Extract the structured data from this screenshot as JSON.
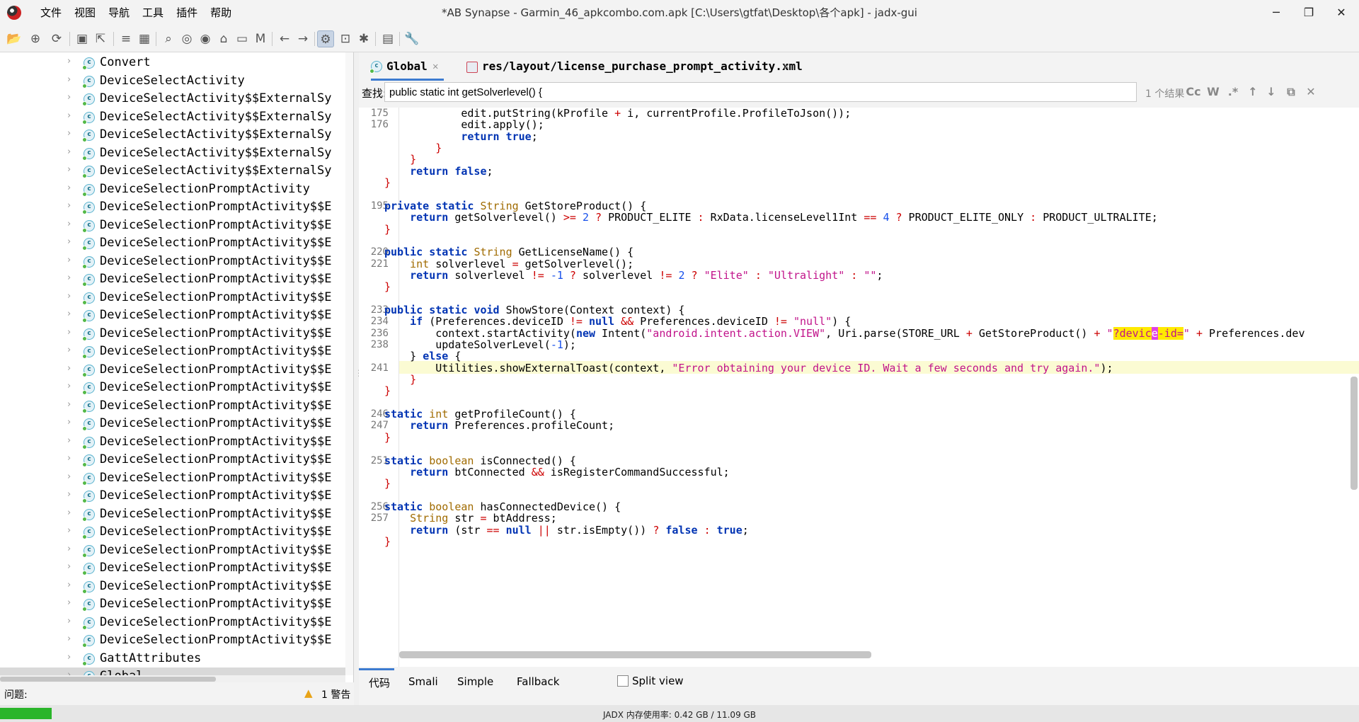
{
  "window": {
    "title": "*AB Synapse - Garmin_46_apkcombo.com.apk [C:\\Users\\gtfat\\Desktop\\各个apk] - jadx-gui",
    "minimize": "─",
    "maximize": "❐",
    "close": "✕"
  },
  "menu": [
    "文件",
    "视图",
    "导航",
    "工具",
    "插件",
    "帮助"
  ],
  "toolbar_icons": [
    "open-icon",
    "add-file-icon",
    "sync-icon",
    "save-icon",
    "export-icon",
    "text-search-icon",
    "class-search-icon",
    "search-icon",
    "usage-search-icon",
    "find-usage-icon",
    "home-icon",
    "window-icon",
    "kotlin-icon",
    "back-icon",
    "forward-icon",
    "deobfuscation-icon",
    "quark-icon",
    "debug-icon",
    "log-icon",
    "settings-icon"
  ],
  "tree": {
    "items": [
      {
        "label": "Convert",
        "selected": false
      },
      {
        "label": "DeviceSelectActivity",
        "selected": false
      },
      {
        "label": "DeviceSelectActivity$$ExternalSy",
        "selected": false
      },
      {
        "label": "DeviceSelectActivity$$ExternalSy",
        "selected": false
      },
      {
        "label": "DeviceSelectActivity$$ExternalSy",
        "selected": false
      },
      {
        "label": "DeviceSelectActivity$$ExternalSy",
        "selected": false
      },
      {
        "label": "DeviceSelectActivity$$ExternalSy",
        "selected": false
      },
      {
        "label": "DeviceSelectionPromptActivity",
        "selected": false
      },
      {
        "label": "DeviceSelectionPromptActivity$$E",
        "selected": false
      },
      {
        "label": "DeviceSelectionPromptActivity$$E",
        "selected": false
      },
      {
        "label": "DeviceSelectionPromptActivity$$E",
        "selected": false
      },
      {
        "label": "DeviceSelectionPromptActivity$$E",
        "selected": false
      },
      {
        "label": "DeviceSelectionPromptActivity$$E",
        "selected": false
      },
      {
        "label": "DeviceSelectionPromptActivity$$E",
        "selected": false
      },
      {
        "label": "DeviceSelectionPromptActivity$$E",
        "selected": false
      },
      {
        "label": "DeviceSelectionPromptActivity$$E",
        "selected": false
      },
      {
        "label": "DeviceSelectionPromptActivity$$E",
        "selected": false
      },
      {
        "label": "DeviceSelectionPromptActivity$$E",
        "selected": false
      },
      {
        "label": "DeviceSelectionPromptActivity$$E",
        "selected": false
      },
      {
        "label": "DeviceSelectionPromptActivity$$E",
        "selected": false
      },
      {
        "label": "DeviceSelectionPromptActivity$$E",
        "selected": false
      },
      {
        "label": "DeviceSelectionPromptActivity$$E",
        "selected": false
      },
      {
        "label": "DeviceSelectionPromptActivity$$E",
        "selected": false
      },
      {
        "label": "DeviceSelectionPromptActivity$$E",
        "selected": false
      },
      {
        "label": "DeviceSelectionPromptActivity$$E",
        "selected": false
      },
      {
        "label": "DeviceSelectionPromptActivity$$E",
        "selected": false
      },
      {
        "label": "DeviceSelectionPromptActivity$$E",
        "selected": false
      },
      {
        "label": "DeviceSelectionPromptActivity$$E",
        "selected": false
      },
      {
        "label": "DeviceSelectionPromptActivity$$E",
        "selected": false
      },
      {
        "label": "DeviceSelectionPromptActivity$$E",
        "selected": false
      },
      {
        "label": "DeviceSelectionPromptActivity$$E",
        "selected": false
      },
      {
        "label": "DeviceSelectionPromptActivity$$E",
        "selected": false
      },
      {
        "label": "DeviceSelectionPromptActivity$$E",
        "selected": false
      },
      {
        "label": "GattAttributes",
        "selected": false
      },
      {
        "label": "Global",
        "selected": true
      }
    ]
  },
  "problems": {
    "label": "问题:",
    "warning": "1 警告"
  },
  "tabs": [
    {
      "label": "Global",
      "active": true,
      "icon": "class-icon"
    },
    {
      "label": "res/layout/license_purchase_prompt_activity.xml",
      "active": false,
      "icon": "xml-icon"
    }
  ],
  "search": {
    "label": "查找:",
    "value": "public static int getSolverlevel() {",
    "count": "1 个结果",
    "opt_case": "Cc",
    "opt_word": "W",
    "opt_regex": ".*",
    "opt_up": "↑",
    "opt_down": "↓",
    "opt_find": "⧉",
    "opt_close": "✕"
  },
  "code": {
    "line_numbers": [
      {
        "n": "175",
        "row": 0
      },
      {
        "n": "176",
        "row": 1
      },
      {
        "n": "195",
        "row": 8
      },
      {
        "n": "220",
        "row": 12
      },
      {
        "n": "221",
        "row": 13
      },
      {
        "n": "233",
        "row": 17
      },
      {
        "n": "234",
        "row": 18
      },
      {
        "n": "236",
        "row": 19
      },
      {
        "n": "238",
        "row": 20
      },
      {
        "n": "241",
        "row": 22
      },
      {
        "n": "246",
        "row": 26
      },
      {
        "n": "247",
        "row": 27
      },
      {
        "n": "251",
        "row": 30
      },
      {
        "n": "256",
        "row": 34
      },
      {
        "n": "257",
        "row": 35
      }
    ],
    "lines": [
      [
        {
          "t": "            edit.putString(kProfile "
        },
        {
          "t": "+",
          "c": "op"
        },
        {
          "t": " i, currentProfile.ProfileToJson());"
        }
      ],
      [
        {
          "t": "            edit.apply();"
        }
      ],
      [
        {
          "t": "            "
        },
        {
          "t": "return",
          "c": "kw"
        },
        {
          "t": " "
        },
        {
          "t": "true",
          "c": "kw"
        },
        {
          "t": ";"
        }
      ],
      [
        {
          "t": "        }",
          "c": "op"
        }
      ],
      [
        {
          "t": "    }",
          "c": "op"
        }
      ],
      [
        {
          "t": "    "
        },
        {
          "t": "return",
          "c": "kw"
        },
        {
          "t": " "
        },
        {
          "t": "false",
          "c": "kw"
        },
        {
          "t": ";"
        }
      ],
      [
        {
          "t": "}",
          "c": "op"
        }
      ],
      [
        {
          "t": ""
        }
      ],
      [
        {
          "t": "private",
          "c": "kw"
        },
        {
          "t": " "
        },
        {
          "t": "static",
          "c": "kw"
        },
        {
          "t": " "
        },
        {
          "t": "String",
          "c": "ty"
        },
        {
          "t": " GetStoreProduct() {"
        }
      ],
      [
        {
          "t": "    "
        },
        {
          "t": "return",
          "c": "kw"
        },
        {
          "t": " getSolverlevel() "
        },
        {
          "t": ">=",
          "c": "op"
        },
        {
          "t": " "
        },
        {
          "t": "2",
          "c": "num"
        },
        {
          "t": " "
        },
        {
          "t": "?",
          "c": "op"
        },
        {
          "t": " PRODUCT_ELITE "
        },
        {
          "t": ":",
          "c": "op"
        },
        {
          "t": " RxData.licenseLevel1Int "
        },
        {
          "t": "==",
          "c": "op"
        },
        {
          "t": " "
        },
        {
          "t": "4",
          "c": "num"
        },
        {
          "t": " "
        },
        {
          "t": "?",
          "c": "op"
        },
        {
          "t": " PRODUCT_ELITE_ONLY "
        },
        {
          "t": ":",
          "c": "op"
        },
        {
          "t": " PRODUCT_ULTRALITE;"
        }
      ],
      [
        {
          "t": "}",
          "c": "op"
        }
      ],
      [
        {
          "t": ""
        }
      ],
      [
        {
          "t": "public",
          "c": "kw"
        },
        {
          "t": " "
        },
        {
          "t": "static",
          "c": "kw"
        },
        {
          "t": " "
        },
        {
          "t": "String",
          "c": "ty"
        },
        {
          "t": " GetLicenseName() {"
        }
      ],
      [
        {
          "t": "    "
        },
        {
          "t": "int",
          "c": "ty"
        },
        {
          "t": " solverlevel "
        },
        {
          "t": "=",
          "c": "op"
        },
        {
          "t": " getSolverlevel();"
        }
      ],
      [
        {
          "t": "    "
        },
        {
          "t": "return",
          "c": "kw"
        },
        {
          "t": " solverlevel "
        },
        {
          "t": "!=",
          "c": "op"
        },
        {
          "t": " "
        },
        {
          "t": "-1",
          "c": "num"
        },
        {
          "t": " "
        },
        {
          "t": "?",
          "c": "op"
        },
        {
          "t": " solverlevel "
        },
        {
          "t": "!=",
          "c": "op"
        },
        {
          "t": " "
        },
        {
          "t": "2",
          "c": "num"
        },
        {
          "t": " "
        },
        {
          "t": "?",
          "c": "op"
        },
        {
          "t": " "
        },
        {
          "t": "\"Elite\"",
          "c": "str"
        },
        {
          "t": " "
        },
        {
          "t": ":",
          "c": "op"
        },
        {
          "t": " "
        },
        {
          "t": "\"Ultralight\"",
          "c": "str"
        },
        {
          "t": " "
        },
        {
          "t": ":",
          "c": "op"
        },
        {
          "t": " "
        },
        {
          "t": "\"\"",
          "c": "str"
        },
        {
          "t": ";"
        }
      ],
      [
        {
          "t": "}",
          "c": "op"
        }
      ],
      [
        {
          "t": ""
        }
      ],
      [
        {
          "t": "public",
          "c": "kw"
        },
        {
          "t": " "
        },
        {
          "t": "static",
          "c": "kw"
        },
        {
          "t": " "
        },
        {
          "t": "void",
          "c": "kw"
        },
        {
          "t": " ShowStore(Context context) {"
        }
      ],
      [
        {
          "t": "    "
        },
        {
          "t": "if",
          "c": "kw"
        },
        {
          "t": " (Preferences.deviceID "
        },
        {
          "t": "!=",
          "c": "op"
        },
        {
          "t": " "
        },
        {
          "t": "null",
          "c": "kw"
        },
        {
          "t": " "
        },
        {
          "t": "&&",
          "c": "op"
        },
        {
          "t": " Preferences.deviceID "
        },
        {
          "t": "!=",
          "c": "op"
        },
        {
          "t": " "
        },
        {
          "t": "\"null\"",
          "c": "str"
        },
        {
          "t": ") {"
        }
      ],
      [
        {
          "t": "        context.startActivity("
        },
        {
          "t": "new",
          "c": "kw"
        },
        {
          "t": " Intent("
        },
        {
          "t": "\"android.intent.action.VIEW\"",
          "c": "str"
        },
        {
          "t": ", Uri.parse(STORE_URL "
        },
        {
          "t": "+",
          "c": "op"
        },
        {
          "t": " GetStoreProduct() "
        },
        {
          "t": "+",
          "c": "op"
        },
        {
          "t": " "
        },
        {
          "t": "\"",
          "c": "str"
        },
        {
          "t": "?devic",
          "c": "str hit"
        },
        {
          "t": "e",
          "c": "hitsel"
        },
        {
          "t": "-id=",
          "c": "str hit"
        },
        {
          "t": "\"",
          "c": "str"
        },
        {
          "t": " "
        },
        {
          "t": "+",
          "c": "op"
        },
        {
          "t": " Preferences.dev"
        }
      ],
      [
        {
          "t": "        updateSolverLevel("
        },
        {
          "t": "-1",
          "c": "num"
        },
        {
          "t": ");"
        }
      ],
      [
        {
          "t": "    } "
        },
        {
          "t": "else",
          "c": "kw"
        },
        {
          "t": " {"
        }
      ],
      [
        {
          "t": "        Utilities.showExternalToast(context, "
        },
        {
          "t": "\"Error obtaining your device ID. Wait a few seconds and try again.\"",
          "c": "str"
        },
        {
          "t": ");"
        }
      ],
      [
        {
          "t": "    }",
          "c": "op"
        }
      ],
      [
        {
          "t": "}",
          "c": "op"
        }
      ],
      [
        {
          "t": ""
        }
      ],
      [
        {
          "t": "static",
          "c": "kw"
        },
        {
          "t": " "
        },
        {
          "t": "int",
          "c": "ty"
        },
        {
          "t": " getProfileCount() {"
        }
      ],
      [
        {
          "t": "    "
        },
        {
          "t": "return",
          "c": "kw"
        },
        {
          "t": " Preferences.profileCount;"
        }
      ],
      [
        {
          "t": "}",
          "c": "op"
        }
      ],
      [
        {
          "t": ""
        }
      ],
      [
        {
          "t": "static",
          "c": "kw"
        },
        {
          "t": " "
        },
        {
          "t": "boolean",
          "c": "ty"
        },
        {
          "t": " isConnected() {"
        }
      ],
      [
        {
          "t": "    "
        },
        {
          "t": "return",
          "c": "kw"
        },
        {
          "t": " btConnected "
        },
        {
          "t": "&&",
          "c": "op"
        },
        {
          "t": " isRegisterCommandSuccessful;"
        }
      ],
      [
        {
          "t": "}",
          "c": "op"
        }
      ],
      [
        {
          "t": ""
        }
      ],
      [
        {
          "t": "static",
          "c": "kw"
        },
        {
          "t": " "
        },
        {
          "t": "boolean",
          "c": "ty"
        },
        {
          "t": " hasConnectedDevice() {"
        }
      ],
      [
        {
          "t": "    "
        },
        {
          "t": "String",
          "c": "ty"
        },
        {
          "t": " str "
        },
        {
          "t": "=",
          "c": "op"
        },
        {
          "t": " btAddress;"
        }
      ],
      [
        {
          "t": "    "
        },
        {
          "t": "return",
          "c": "kw"
        },
        {
          "t": " (str "
        },
        {
          "t": "==",
          "c": "op"
        },
        {
          "t": " "
        },
        {
          "t": "null",
          "c": "kw"
        },
        {
          "t": " "
        },
        {
          "t": "||",
          "c": "op"
        },
        {
          "t": " str.isEmpty()) "
        },
        {
          "t": "?",
          "c": "op"
        },
        {
          "t": " "
        },
        {
          "t": "false",
          "c": "kw"
        },
        {
          "t": " "
        },
        {
          "t": ":",
          "c": "op"
        },
        {
          "t": " "
        },
        {
          "t": "true",
          "c": "kw"
        },
        {
          "t": ";"
        }
      ],
      [
        {
          "t": "}",
          "c": "op"
        }
      ]
    ]
  },
  "bottom_tabs": {
    "code": "代码",
    "smali": "Smali",
    "simple": "Simple",
    "fallback": "Fallback",
    "split_view": "Split view"
  },
  "memory": {
    "text": "JADX 内存使用率: 0.42 GB / 11.09 GB",
    "used_fraction": 0.038
  }
}
